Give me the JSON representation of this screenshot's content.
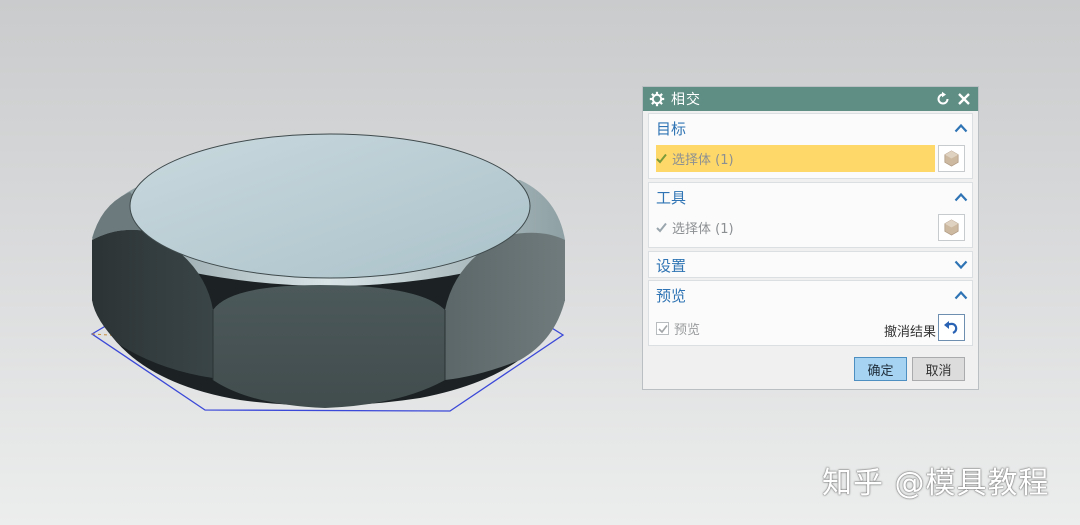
{
  "dialog": {
    "title": "相交",
    "title_icon": "gear-icon",
    "reset_icon": "reset-icon",
    "close_icon": "close-icon",
    "groups": {
      "target": {
        "label": "目标",
        "state": "expanded",
        "select_label": "选择体 (1)"
      },
      "tool": {
        "label": "工具",
        "state": "expanded",
        "select_label": "选择体 (1)"
      },
      "settings": {
        "label": "设置",
        "state": "collapsed"
      },
      "preview": {
        "label": "预览",
        "state": "expanded",
        "checkbox_label": "预览",
        "checkbox_checked": true,
        "undo_label": "撤消结果"
      }
    },
    "ok_label": "确定",
    "cancel_label": "取消"
  },
  "colors": {
    "titlebar": "#5e8e84",
    "selection_highlight": "#fed96a",
    "group_header_text": "#2f74b4",
    "model_top_face": "#b9ccd3",
    "model_side": "#4a5557",
    "sketch_outline": "#3b49d8"
  },
  "watermark": "知乎 @模具教程"
}
